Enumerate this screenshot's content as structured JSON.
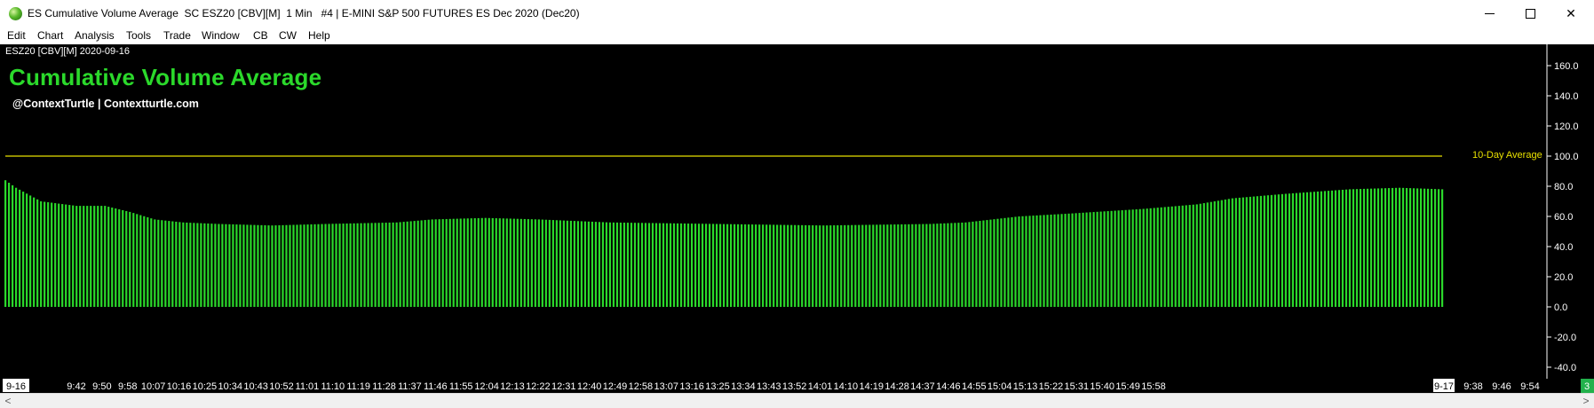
{
  "window": {
    "title": "ES Cumulative Volume Average  SC ESZ20 [CBV][M]  1 Min   #4 | E-MINI S&P 500 FUTURES ES Dec 2020 (Dec20)",
    "minimize_icon": "minimize-icon",
    "maximize_icon": "maximize-icon",
    "close_icon": "close-icon",
    "close_glyph": "✕"
  },
  "menu": [
    "Edit",
    "Chart",
    "Analysis",
    "Tools",
    "Trade",
    "Window",
    "CB",
    "CW",
    "Help"
  ],
  "chart": {
    "symbol_label": "ESZ20 [CBV][M] 2020-09-16",
    "title": "Cumulative Volume Average",
    "subtitle": "@ContextTurtle | Contextturtle.com",
    "avg_label": "10-Day Average",
    "scroll_number": "3",
    "colors": {
      "background": "#000000",
      "bars": "#2bd92b",
      "average_line": "#e8e000",
      "axis": "#ffffff"
    }
  },
  "scrollbar": {
    "left_arrow": "<",
    "right_arrow": ">"
  },
  "chart_data": {
    "type": "bar",
    "title": "Cumulative Volume Average",
    "ylim": [
      -45,
      170
    ],
    "yticks": [
      "160.0",
      "140.0",
      "120.0",
      "100.0",
      "80.0",
      "60.0",
      "40.0",
      "20.0",
      "0.0",
      "-20.0",
      "-40.0"
    ],
    "ytick_values": [
      160,
      140,
      120,
      100,
      80,
      60,
      40,
      20,
      0,
      -20,
      -40
    ],
    "average_line": 100,
    "xticks": [
      "9-16",
      "9:42",
      "9:50",
      "9:58",
      "10:07",
      "10:16",
      "10:25",
      "10:34",
      "10:43",
      "10:52",
      "11:01",
      "11:10",
      "11:19",
      "11:28",
      "11:37",
      "11:46",
      "11:55",
      "12:04",
      "12:13",
      "12:22",
      "12:31",
      "12:40",
      "12:49",
      "12:58",
      "13:07",
      "13:16",
      "13:25",
      "13:34",
      "13:43",
      "13:52",
      "14:01",
      "14:10",
      "14:19",
      "14:28",
      "14:37",
      "14:46",
      "14:55",
      "15:04",
      "15:13",
      "15:22",
      "15:31",
      "15:40",
      "15:49",
      "15:58",
      "9-17",
      "9:38",
      "9:46",
      "9:54"
    ],
    "bar_count": 405,
    "profile": [
      [
        0,
        84
      ],
      [
        3,
        79
      ],
      [
        10,
        70
      ],
      [
        20,
        67
      ],
      [
        28,
        67
      ],
      [
        35,
        63
      ],
      [
        42,
        58
      ],
      [
        50,
        56
      ],
      [
        60,
        55
      ],
      [
        75,
        54
      ],
      [
        90,
        55
      ],
      [
        110,
        56
      ],
      [
        120,
        58
      ],
      [
        135,
        59
      ],
      [
        150,
        58
      ],
      [
        170,
        56
      ],
      [
        200,
        55
      ],
      [
        230,
        54
      ],
      [
        260,
        55
      ],
      [
        270,
        56
      ],
      [
        285,
        60
      ],
      [
        300,
        62
      ],
      [
        320,
        65
      ],
      [
        335,
        68
      ],
      [
        345,
        72
      ],
      [
        360,
        75
      ],
      [
        378,
        78
      ],
      [
        392,
        79
      ],
      [
        404,
        78
      ]
    ]
  }
}
